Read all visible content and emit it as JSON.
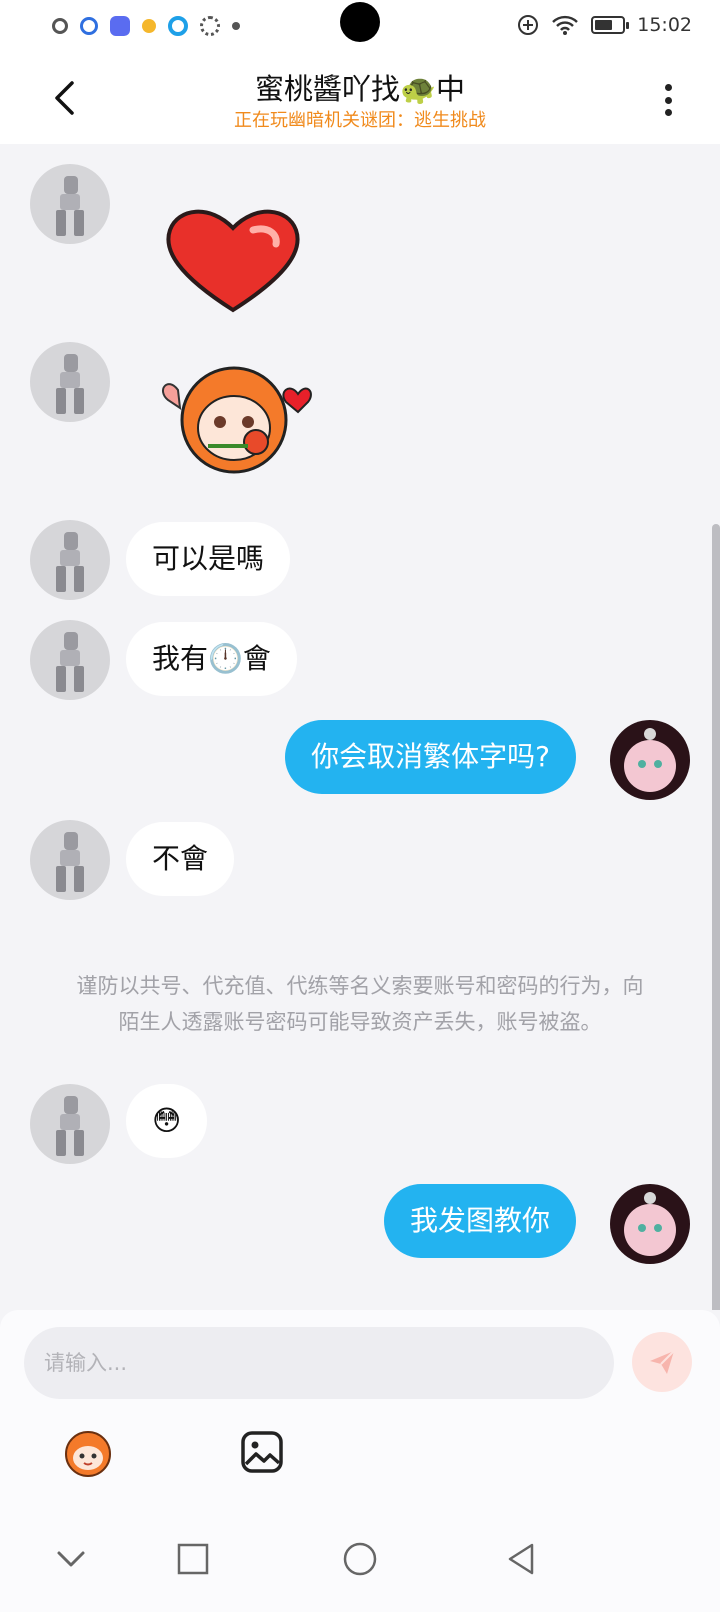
{
  "status_bar": {
    "time": "15:02",
    "left_icons": [
      "app-icon-1",
      "q-icon",
      "bot-icon",
      "dot-icon",
      "target-icon",
      "gear-icon",
      "dot-icon"
    ],
    "right_icons": [
      "add-circle-icon",
      "wifi-icon",
      "battery-icon"
    ]
  },
  "header": {
    "title": "蜜桃醬吖找🐢中",
    "subtitle": "正在玩幽暗机关谜团：逃生挑战",
    "subtitle_color": "#f08a1c",
    "back_icon": "chevron-left-icon",
    "more_icon": "more-vertical-icon"
  },
  "messages": [
    {
      "side": "in",
      "type": "sticker",
      "sticker": "heart-sticker"
    },
    {
      "side": "in",
      "type": "sticker",
      "sticker": "anime-girl-rose-sticker"
    },
    {
      "side": "in",
      "type": "text",
      "text": "可以是嗎"
    },
    {
      "side": "in",
      "type": "text",
      "text": "我有🕛會"
    },
    {
      "side": "out",
      "type": "text",
      "text": "你会取消繁体字吗?"
    },
    {
      "side": "in",
      "type": "text",
      "text": "不會"
    },
    {
      "side": "system",
      "type": "notice",
      "text": "谨防以共号、代充值、代练等名义索要账号和密码的行为，向陌生人透露账号密码可能导致资产丢失，账号被盗。"
    },
    {
      "side": "in",
      "type": "text",
      "text": "😳"
    },
    {
      "side": "out",
      "type": "text",
      "text": "我发图教你"
    }
  ],
  "colors": {
    "outgoing_bubble": "#23b3f0",
    "incoming_bubble": "#ffffff",
    "background": "#f4f4f7"
  },
  "input": {
    "placeholder": "请输入...",
    "value": "",
    "send_icon": "send-icon"
  },
  "toolbar": {
    "items": [
      "emoji-avatar-icon",
      "image-icon"
    ]
  },
  "nav_bar": {
    "items": [
      "chevron-down-icon",
      "square-icon",
      "circle-icon",
      "triangle-back-icon"
    ]
  }
}
